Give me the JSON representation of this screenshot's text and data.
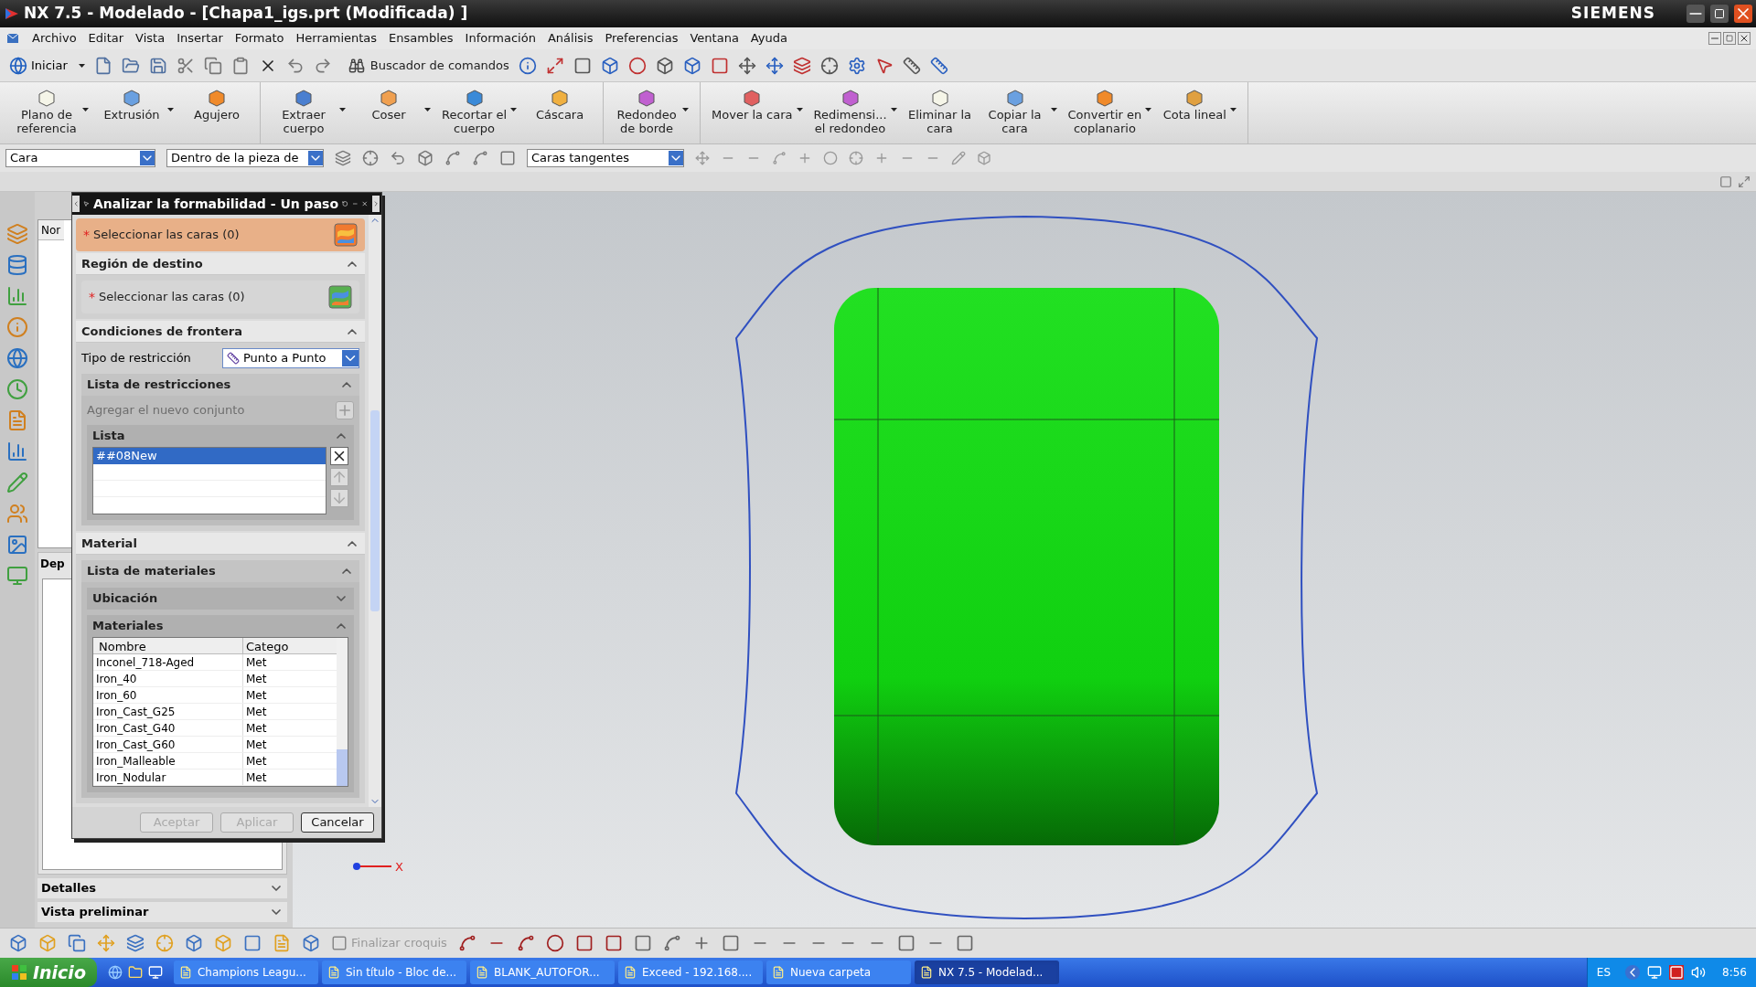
{
  "window": {
    "title": "NX 7.5 - Modelado - [Chapa1_igs.prt (Modificada) ]",
    "brand": "SIEMENS"
  },
  "menu": [
    "Archivo",
    "Editar",
    "Vista",
    "Insertar",
    "Formato",
    "Herramientas",
    "Ensambles",
    "Información",
    "Análisis",
    "Preferencias",
    "Ventana",
    "Ayuda"
  ],
  "toolbar": {
    "start_label": "Iniciar",
    "command_finder": "Buscador de comandos"
  },
  "ribbon": [
    [
      {
        "label": "Plano de\nreferencia",
        "dropdown": true
      },
      {
        "label": "Extrusión",
        "dropdown": true
      },
      {
        "label": "Agujero",
        "dropdown": false
      }
    ],
    [
      {
        "label": "Extraer\ncuerpo",
        "dropdown": true
      },
      {
        "label": "Coser",
        "dropdown": true
      },
      {
        "label": "Recortar el\ncuerpo",
        "dropdown": true
      },
      {
        "label": "Cáscara",
        "dropdown": false
      }
    ],
    [
      {
        "label": "Redondeo\nde borde",
        "dropdown": true
      }
    ],
    [
      {
        "label": "Mover la cara",
        "dropdown": true
      },
      {
        "label": "Redimensi...\nel redondeo",
        "dropdown": true
      },
      {
        "label": "Eliminar la\ncara",
        "dropdown": false
      },
      {
        "label": "Copiar la\ncara",
        "dropdown": true
      },
      {
        "label": "Convertir en\ncoplanario",
        "dropdown": true
      },
      {
        "label": "Cota lineal",
        "dropdown": true
      }
    ]
  ],
  "selection_bar": {
    "type_filter": "Cara",
    "scope": "Dentro de la pieza de",
    "face_rule": "Caras tangentes"
  },
  "navigator": {
    "column_header": "Nor",
    "dependency_header": "Dep",
    "panels": [
      {
        "title": "Detalles",
        "expanded": false
      },
      {
        "title": "Vista preliminar",
        "expanded": false
      }
    ]
  },
  "dialog": {
    "title": "Analizar la formabilidad - Un paso",
    "selection": {
      "marker": "*",
      "label": "Seleccionar las caras (0)",
      "active": true
    },
    "target_region": {
      "title": "Región de destino",
      "expanded": true,
      "selection": {
        "marker": "*",
        "label": "Seleccionar las caras (0)",
        "active": false
      }
    },
    "boundary": {
      "title": "Condiciones de frontera",
      "expanded": true,
      "constraint_type": {
        "label": "Tipo de restricción",
        "value": "Punto a Punto"
      },
      "constraint_list": {
        "title": "Lista de restricciones",
        "expanded": true,
        "add_set": {
          "label": "Agregar el nuevo conjunto",
          "disabled": true
        },
        "list": {
          "title": "Lista",
          "expanded": true,
          "rows": [
            {
              "name": "##08New",
              "selected": true
            }
          ]
        }
      }
    },
    "material": {
      "title": "Material",
      "expanded": true,
      "material_list": {
        "title": "Lista de materiales",
        "expanded": true,
        "location": {
          "title": "Ubicación",
          "expanded": false
        },
        "materials": {
          "title": "Materiales",
          "expanded": true,
          "columns": [
            "Nombre",
            "Catego"
          ],
          "rows": [
            [
              "Inconel_718-Aged",
              "Met"
            ],
            [
              "Iron_40",
              "Met"
            ],
            [
              "Iron_60",
              "Met"
            ],
            [
              "Iron_Cast_G25",
              "Met"
            ],
            [
              "Iron_Cast_G40",
              "Met"
            ],
            [
              "Iron_Cast_G60",
              "Met"
            ],
            [
              "Iron_Malleable",
              "Met"
            ],
            [
              "Iron_Nodular",
              "Met"
            ]
          ]
        }
      }
    },
    "buttons": [
      {
        "label": "Aceptar",
        "disabled": true
      },
      {
        "label": "Aplicar",
        "disabled": true
      },
      {
        "label": "Cancelar",
        "disabled": false
      }
    ]
  },
  "viewport": {
    "axis_label": "X"
  },
  "bottom_toolbar": {
    "finish_sketch": {
      "label": "Finalizar croquis",
      "disabled": true
    }
  },
  "taskbar": {
    "start": "Inicio",
    "tasks": [
      {
        "label": "Champions Leagu...",
        "selected": false
      },
      {
        "label": "Sin título - Bloc de...",
        "selected": false
      },
      {
        "label": "BLANK_AUTOFOR...",
        "selected": false
      },
      {
        "label": "Exceed - 192.168....",
        "selected": false
      },
      {
        "label": "Nueva carpeta",
        "selected": false
      },
      {
        "label": "NX 7.5 - Modelad...",
        "selected": true
      }
    ],
    "language": "ES",
    "clock": "8:56"
  }
}
